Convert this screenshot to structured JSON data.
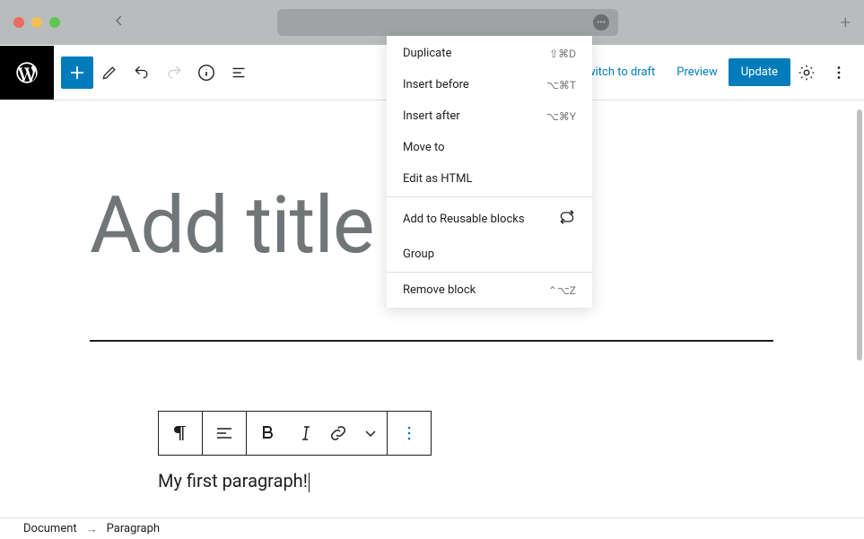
{
  "header": {
    "switch_draft": "Switch to draft",
    "preview": "Preview",
    "update": "Update"
  },
  "canvas": {
    "title_placeholder": "Add title",
    "paragraph_text": "My first paragraph!"
  },
  "context_menu": {
    "duplicate": {
      "label": "Duplicate",
      "shortcut": "⇧⌘D"
    },
    "insert_before": {
      "label": "Insert before",
      "shortcut": "⌥⌘T"
    },
    "insert_after": {
      "label": "Insert after",
      "shortcut": "⌥⌘Y"
    },
    "move_to": {
      "label": "Move to"
    },
    "edit_html": {
      "label": "Edit as HTML"
    },
    "add_reusable": {
      "label": "Add to Reusable blocks"
    },
    "group": {
      "label": "Group"
    },
    "remove": {
      "label": "Remove block",
      "shortcut": "⌃⌥Z"
    }
  },
  "breadcrumb": {
    "root": "Document",
    "current": "Paragraph"
  }
}
